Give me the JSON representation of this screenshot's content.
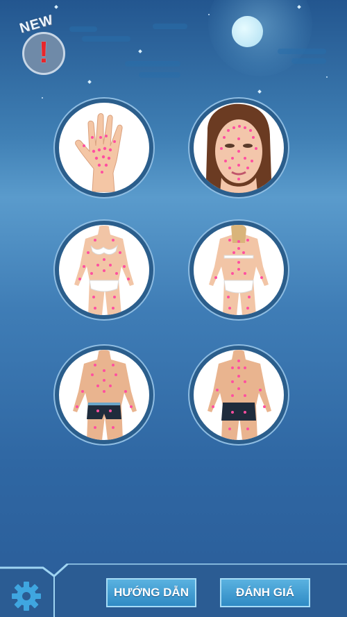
{
  "badge": {
    "label": "NEW",
    "mark": "!"
  },
  "options": [
    {
      "name": "hand",
      "icon": "hand-reflexology-icon"
    },
    {
      "name": "face",
      "icon": "face-reflexology-icon"
    },
    {
      "name": "female-front",
      "icon": "female-body-front-icon"
    },
    {
      "name": "female-back",
      "icon": "female-body-back-icon"
    },
    {
      "name": "male-front",
      "icon": "male-body-front-icon"
    },
    {
      "name": "male-back",
      "icon": "male-body-back-icon"
    }
  ],
  "footer": {
    "guide_label": "HƯỚNG DẪN",
    "rate_label": "ĐÁNH GIÁ",
    "settings_icon": "gear-icon"
  },
  "colors": {
    "acupoint": "#ff4fa0",
    "button": "#3f9ed6",
    "circle_border": "#2b5e8c"
  }
}
